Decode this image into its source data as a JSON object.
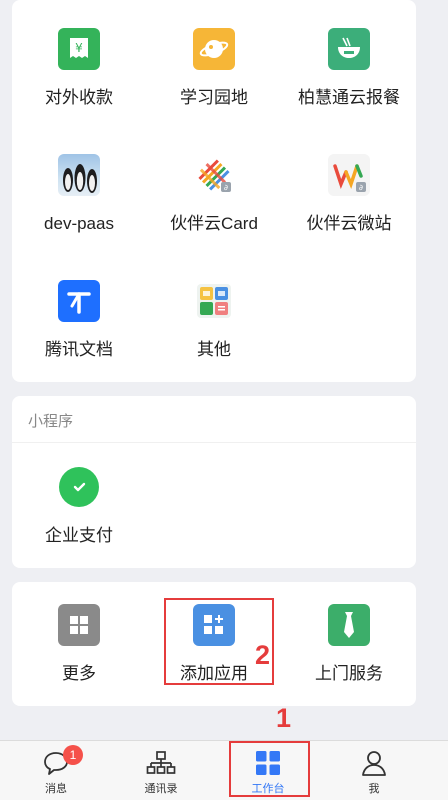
{
  "apps": {
    "row1": [
      {
        "label": "对外收款",
        "icon": "yuan-receipt-icon",
        "color": "#34b35a"
      },
      {
        "label": "学习园地",
        "icon": "planet-icon",
        "color": "#f6b637"
      },
      {
        "label": "柏慧通云报餐",
        "icon": "noodle-bowl-icon",
        "color": "#3cae7a"
      }
    ],
    "row2": [
      {
        "label": "dev-paas",
        "icon": "penguins-photo-icon"
      },
      {
        "label": "伙伴云Card",
        "icon": "woven-card-icon"
      },
      {
        "label": "伙伴云微站",
        "icon": "w-site-icon"
      }
    ],
    "row3": [
      {
        "label": "腾讯文档",
        "icon": "tencent-docs-icon",
        "color": "#1e6fff"
      },
      {
        "label": "其他",
        "icon": "others-grid-icon"
      }
    ]
  },
  "mini_programs": {
    "title": "小程序",
    "items": [
      {
        "label": "企业支付",
        "icon": "check-circle-icon",
        "color": "#2fc25b"
      }
    ]
  },
  "tools": [
    {
      "label": "更多",
      "icon": "more-grid-icon",
      "color": "#8a8a8a"
    },
    {
      "label": "添加应用",
      "icon": "add-app-icon",
      "color": "#4a90e2"
    },
    {
      "label": "上门服务",
      "icon": "tie-service-icon",
      "color": "#3cae6a"
    }
  ],
  "annotations": {
    "box1_number": "1",
    "box2_number": "2"
  },
  "tabbar": {
    "items": [
      {
        "label": "消息",
        "icon": "chat-bubble-icon",
        "badge": "1"
      },
      {
        "label": "通讯录",
        "icon": "org-chart-icon"
      },
      {
        "label": "工作台",
        "icon": "workbench-grid-icon",
        "active": true
      },
      {
        "label": "我",
        "icon": "person-icon"
      }
    ],
    "active_color": "#3478f6"
  }
}
